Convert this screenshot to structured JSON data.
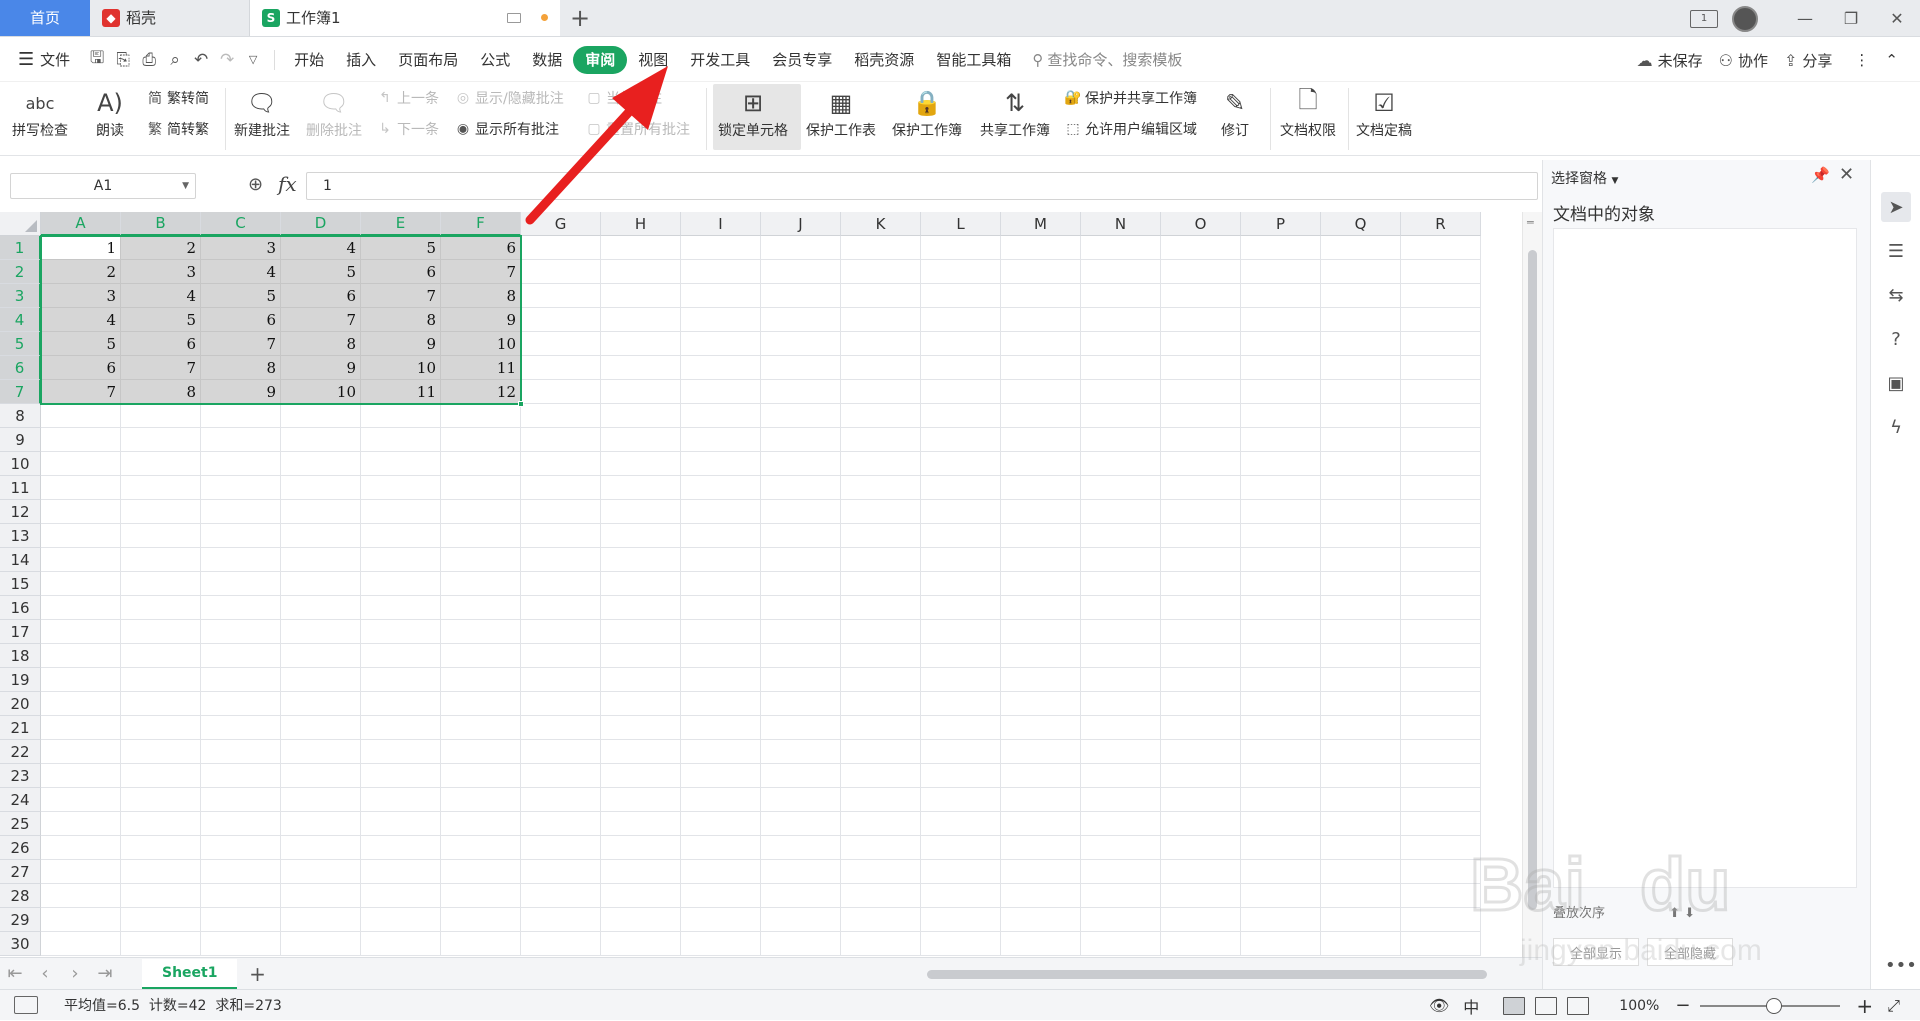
{
  "tabs": {
    "home": "首页",
    "docer": "稻壳",
    "workbook": "工作簿1",
    "add": "+"
  },
  "menu": {
    "file": "文件",
    "items": [
      "开始",
      "插入",
      "页面布局",
      "公式",
      "数据",
      "审阅",
      "视图",
      "开发工具",
      "会员专享",
      "稻壳资源",
      "智能工具箱"
    ],
    "active_index": 5,
    "search": "查找命令、搜索模板",
    "unsaved": "未保存",
    "collab": "协作",
    "share": "分享"
  },
  "ribbon": {
    "spellcheck": "拼写检查",
    "read": "朗读",
    "trad_to_simp": "繁转简",
    "simp_to_trad": "简转繁",
    "new_comment": "新建批注",
    "delete_comment": "删除批注",
    "prev": "上一条",
    "next": "下一条",
    "show_hide_comment": "显示/隐藏批注",
    "show_all_comments": "显示所有批注",
    "current_comment": "当前批注",
    "reset_comments": "重置所有批注",
    "lock_cell": "锁定单元格",
    "protect_sheet": "保护工作表",
    "protect_workbook": "保护工作簿",
    "share_workbook": "共享工作簿",
    "protect_share_workbook": "保护并共享工作簿",
    "allow_edit_range": "允许用户编辑区域",
    "revise": "修订",
    "doc_rights": "文档权限",
    "doc_finalize": "文档定稿"
  },
  "formula_bar": {
    "name_box": "A1",
    "fx": "fx",
    "value": "1"
  },
  "grid": {
    "columns": [
      "A",
      "B",
      "C",
      "D",
      "E",
      "F",
      "G",
      "H",
      "I",
      "J",
      "K",
      "L",
      "M",
      "N",
      "O",
      "P",
      "Q",
      "R"
    ],
    "row_count": 30,
    "values": [
      [
        1,
        2,
        3,
        4,
        5,
        6
      ],
      [
        2,
        3,
        4,
        5,
        6,
        7
      ],
      [
        3,
        4,
        5,
        6,
        7,
        8
      ],
      [
        4,
        5,
        6,
        7,
        8,
        9
      ],
      [
        5,
        6,
        7,
        8,
        9,
        10
      ],
      [
        6,
        7,
        8,
        9,
        10,
        11
      ],
      [
        7,
        8,
        9,
        10,
        11,
        12
      ]
    ]
  },
  "sheetbar": {
    "sheet": "Sheet1",
    "add": "+"
  },
  "status": {
    "stats": "平均值=6.5  计数=42  求和=273",
    "zoom": "100%"
  },
  "pane": {
    "title": "选择窗格",
    "subtitle": "文档中的对象",
    "sort": "叠放次序",
    "show_all": "全部显示",
    "hide_all": "全部隐藏"
  },
  "colors": {
    "accent": "#1aa561",
    "home_tab": "#4a87e8",
    "arrow": "#e8201f"
  }
}
